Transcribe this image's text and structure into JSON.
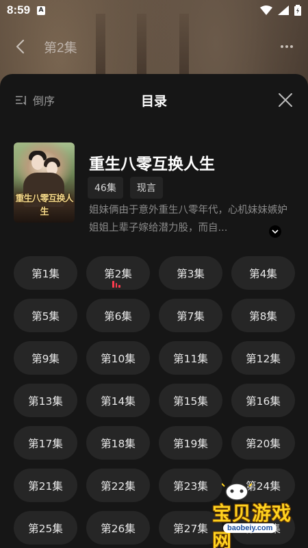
{
  "status_bar": {
    "time": "8:59",
    "notification_badge": "A"
  },
  "nav": {
    "title": "第2集"
  },
  "sheet": {
    "sort_label": "倒序",
    "title": "目录"
  },
  "drama": {
    "title": "重生八零互换人生",
    "cover_text": "重生八零互换人生",
    "tags": [
      "46集",
      "现言"
    ],
    "description": "姐妹俩由于意外重生八零年代，心机妹妹嫉妒姐姐上辈子嫁给潜力股，而自..."
  },
  "episodes": [
    {
      "label": "第1集",
      "playing": false
    },
    {
      "label": "第2集",
      "playing": true
    },
    {
      "label": "第3集",
      "playing": false
    },
    {
      "label": "第4集",
      "playing": false
    },
    {
      "label": "第5集",
      "playing": false
    },
    {
      "label": "第6集",
      "playing": false
    },
    {
      "label": "第7集",
      "playing": false
    },
    {
      "label": "第8集",
      "playing": false
    },
    {
      "label": "第9集",
      "playing": false
    },
    {
      "label": "第10集",
      "playing": false
    },
    {
      "label": "第11集",
      "playing": false
    },
    {
      "label": "第12集",
      "playing": false
    },
    {
      "label": "第13集",
      "playing": false
    },
    {
      "label": "第14集",
      "playing": false
    },
    {
      "label": "第15集",
      "playing": false
    },
    {
      "label": "第16集",
      "playing": false
    },
    {
      "label": "第17集",
      "playing": false
    },
    {
      "label": "第18集",
      "playing": false
    },
    {
      "label": "第19集",
      "playing": false
    },
    {
      "label": "第20集",
      "playing": false
    },
    {
      "label": "第21集",
      "playing": false
    },
    {
      "label": "第22集",
      "playing": false
    },
    {
      "label": "第23集",
      "playing": false
    },
    {
      "label": "第24集",
      "playing": false
    },
    {
      "label": "第25集",
      "playing": false
    },
    {
      "label": "第26集",
      "playing": false
    },
    {
      "label": "第27集",
      "playing": false
    },
    {
      "label": "第28集",
      "playing": false
    }
  ],
  "watermark": {
    "logo_text": "宝贝游戏网",
    "domain": "baobeiy.com"
  },
  "colors": {
    "sheet_bg": "#161616",
    "episode_bg": "#262626",
    "playing_indicator": "#ff3b4e"
  }
}
